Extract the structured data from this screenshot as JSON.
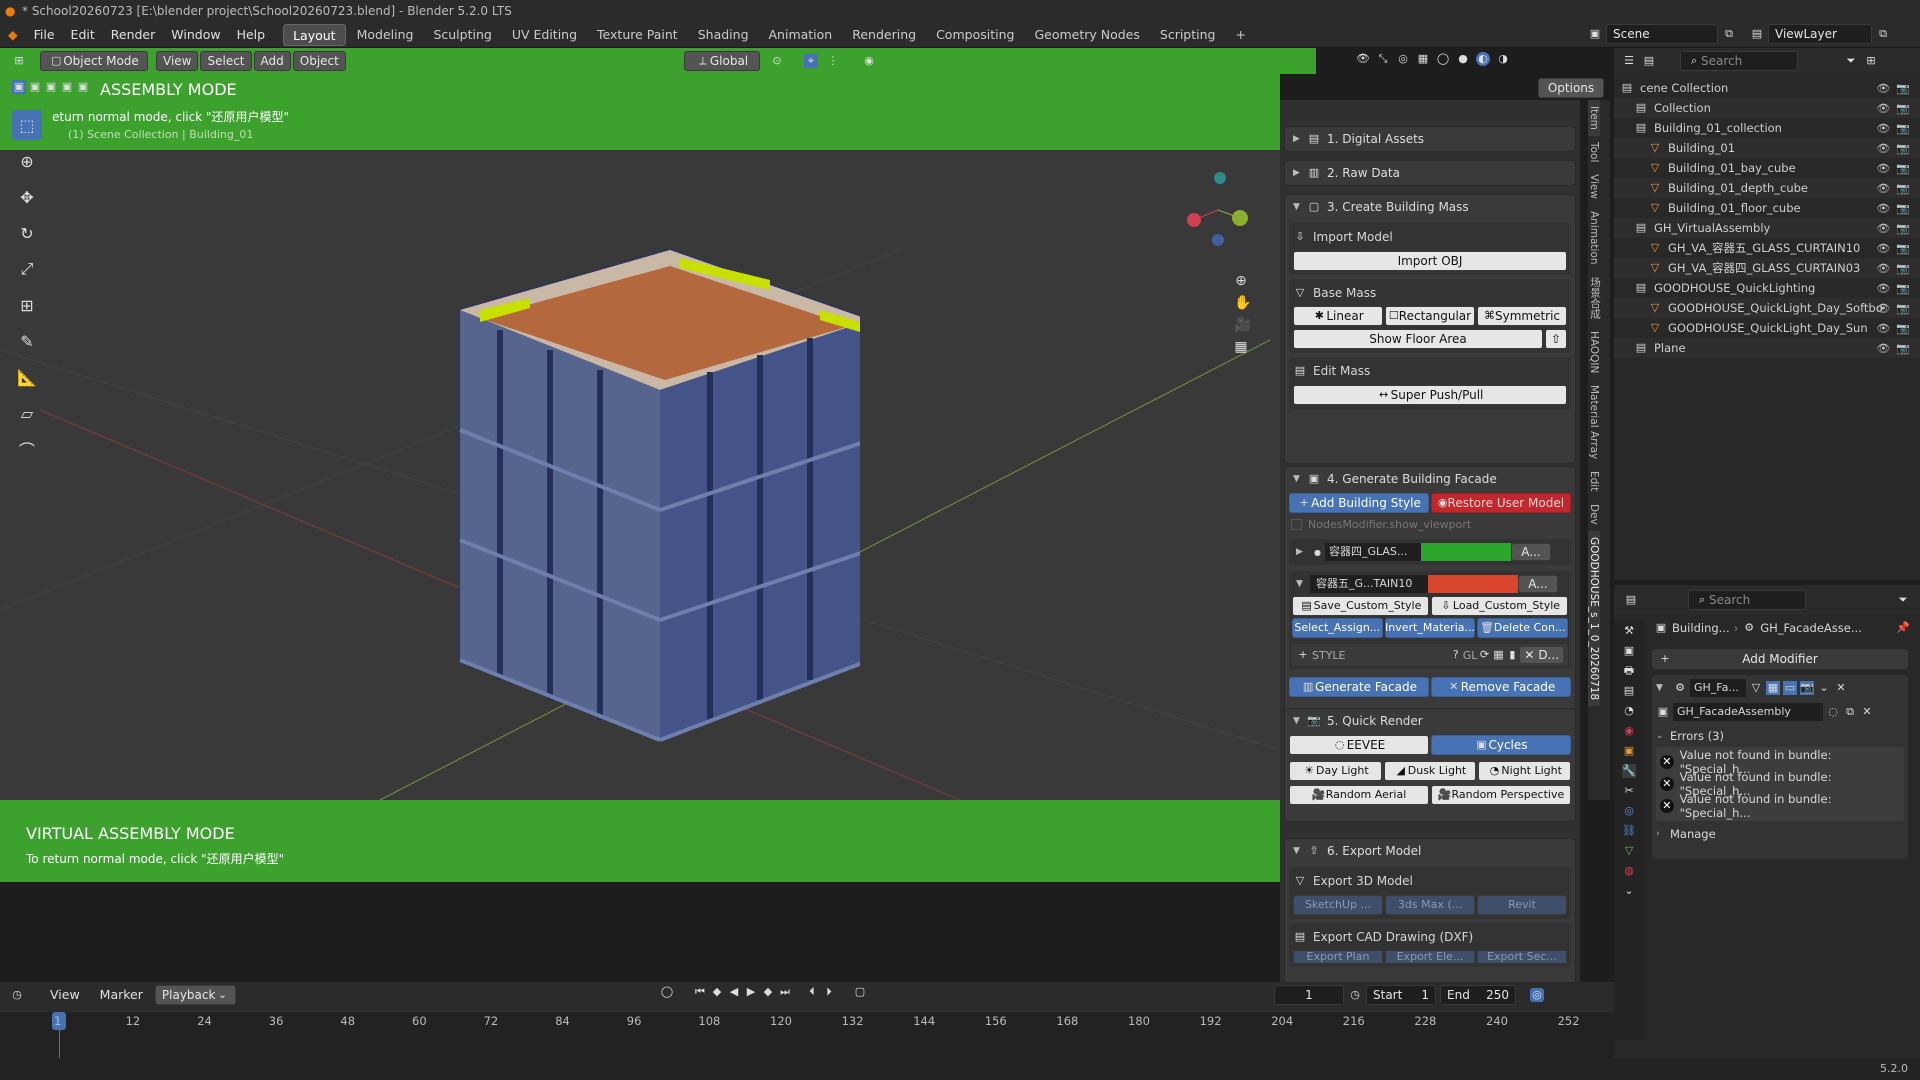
{
  "window": {
    "title": "* School20260723 [E:\\blender project\\School20260723.blend] - Blender 5.2.0 LTS"
  },
  "menu": [
    "File",
    "Edit",
    "Render",
    "Window",
    "Help"
  ],
  "workspaces": [
    "Layout",
    "Modeling",
    "Sculpting",
    "UV Editing",
    "Texture Paint",
    "Shading",
    "Animation",
    "Rendering",
    "Compositing",
    "Geometry Nodes",
    "Scripting"
  ],
  "active_workspace": "Layout",
  "scene": {
    "label": "Scene",
    "viewlayer": "ViewLayer"
  },
  "viewport": {
    "mode": "Object Mode",
    "menus": [
      "View",
      "Select",
      "Add",
      "Object"
    ],
    "orientation": "Global",
    "options": "Options",
    "banner_title": "ASSEMBLY MODE",
    "banner_sub": "eturn normal mode, click \"还原用户模型\"",
    "breadcrumb": "(1) Scene Collection | Building_01",
    "footer_title": "VIRTUAL ASSEMBLY MODE",
    "footer_sub": "To return normal mode, click \"还原用户模型\""
  },
  "npanel": {
    "sections": {
      "s1": "1. Digital Assets",
      "s2": "2. Raw Data",
      "s3": "3. Create Building Mass",
      "import_model": "Import Model",
      "import_obj": "Import OBJ",
      "base_mass": "Base Mass",
      "linear": "Linear",
      "rectangular": "Rectangular",
      "symmetric": "Symmetric",
      "show_floor": "Show Floor Area",
      "edit_mass": "Edit Mass",
      "push_pull": "Super Push/Pull",
      "s4": "4. Generate Building Facade",
      "add_style": "Add Building Style",
      "restore": "Restore User Model",
      "nodes_modifier": "NodesModifier.show_viewport",
      "item1": "容器四_GLAS...",
      "item1_a": "A...",
      "item2": "容器五_G...TAIN10",
      "item2_a": "A...",
      "save_style": "Save_Custom_Style",
      "load_style": "Load_Custom_Style",
      "select_assign": "Select_Assign...",
      "invert_mat": "Invert_Materia...",
      "delete_con": "Delete Con...",
      "style": "STYLE",
      "gl": "GL",
      "d": "D...",
      "gen_facade": "Generate Facade",
      "remove_facade": "Remove Facade",
      "s5": "5. Quick Render",
      "eevee": "EEVEE",
      "cycles": "Cycles",
      "day": "Day Light",
      "dusk": "Dusk Light",
      "night": "Night Light",
      "aerial": "Random Aerial",
      "perspective": "Random Perspective",
      "s6": "6. Export Model",
      "export3d": "Export 3D Model",
      "sketchup": "SketchUp ...",
      "max": "3ds Max (...",
      "revit": "Revit",
      "export_cad": "Export CAD Drawing (DXF)",
      "plan": "Export Plan",
      "ele": "Export Ele...",
      "sec": "Export Sec..."
    },
    "tabs": [
      "Item",
      "Tool",
      "View",
      "Animation",
      "场景合成",
      "HAOQIN",
      "Material Array",
      "Edit",
      "Dev",
      "GOODHOUSE_s_1_0_20260718"
    ]
  },
  "outliner": {
    "search": "Search",
    "rows": [
      {
        "label": "cene Collection",
        "indent": 0
      },
      {
        "label": "Collection",
        "indent": 1
      },
      {
        "label": "Building_01_collection",
        "indent": 1
      },
      {
        "label": "Building_01",
        "indent": 2
      },
      {
        "label": "Building_01_bay_cube",
        "indent": 2
      },
      {
        "label": "Building_01_depth_cube",
        "indent": 2
      },
      {
        "label": "Building_01_floor_cube",
        "indent": 2
      },
      {
        "label": "GH_VirtualAssembly",
        "indent": 1
      },
      {
        "label": "GH_VA_容器五_GLASS_CURTAIN10",
        "indent": 2
      },
      {
        "label": "GH_VA_容器四_GLASS_CURTAIN03",
        "indent": 2
      },
      {
        "label": "GOODHOUSE_QuickLighting",
        "indent": 1
      },
      {
        "label": "GOODHOUSE_QuickLight_Day_Softbo",
        "indent": 2
      },
      {
        "label": "GOODHOUSE_QuickLight_Day_Sun",
        "indent": 2
      },
      {
        "label": "Plane",
        "indent": 1
      }
    ]
  },
  "properties": {
    "search": "Search",
    "path1": "Building...",
    "path2": "GH_FacadeAsse...",
    "add_modifier": "Add Modifier",
    "mod_name": "GH_Fa...",
    "node_group": "GH_FacadeAssembly",
    "errors": "Errors (3)",
    "error_msgs": [
      "Value not found in bundle: \"Special_h...",
      "Value not found in bundle: \"Special_h...",
      "Value not found in bundle: \"Special_h..."
    ],
    "manage": "Manage"
  },
  "timeline": {
    "menus": [
      "View",
      "Marker",
      "Playback"
    ],
    "current": "1",
    "start_label": "Start",
    "start": "1",
    "end_label": "End",
    "end": "250",
    "ticks": [
      "1",
      "12",
      "24",
      "36",
      "48",
      "60",
      "72",
      "84",
      "96",
      "108",
      "120",
      "132",
      "144",
      "156",
      "168",
      "180",
      "192",
      "204",
      "216",
      "228",
      "240",
      "252"
    ]
  },
  "version": "5.2.0"
}
